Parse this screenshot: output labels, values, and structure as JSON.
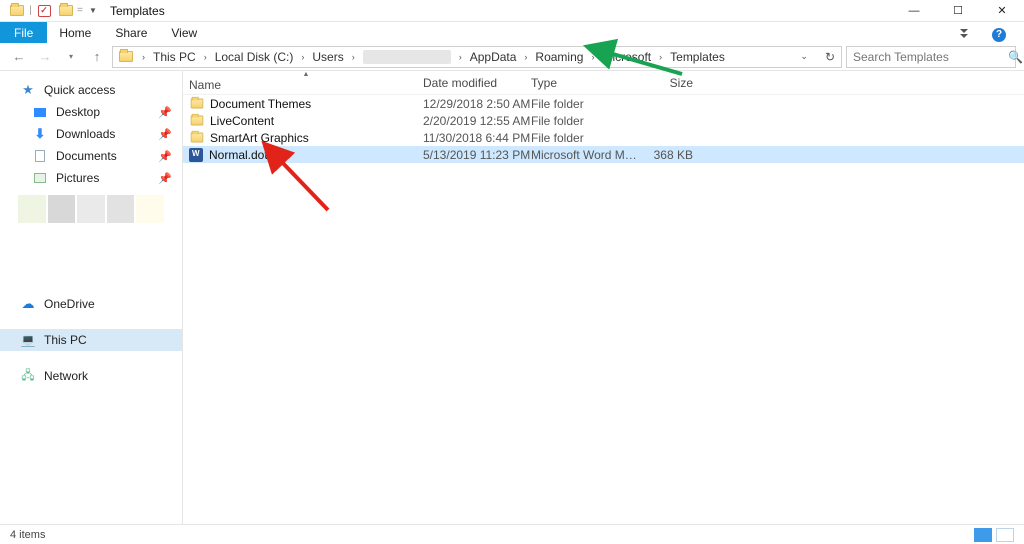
{
  "window": {
    "title": "Templates"
  },
  "ribbon": {
    "file": "File",
    "home": "Home",
    "share": "Share",
    "view": "View"
  },
  "nav": {
    "search_placeholder": "Search Templates",
    "crumbs": [
      "This PC",
      "Local Disk (C:)",
      "Users",
      "",
      "AppData",
      "Roaming",
      "Microsoft",
      "Templates"
    ]
  },
  "sidebar": {
    "quick": "Quick access",
    "desktop": "Desktop",
    "downloads": "Downloads",
    "documents": "Documents",
    "pictures": "Pictures",
    "onedrive": "OneDrive",
    "thispc": "This PC",
    "network": "Network"
  },
  "columns": {
    "name": "Name",
    "date": "Date modified",
    "type": "Type",
    "size": "Size"
  },
  "rows": [
    {
      "name": "Document Themes",
      "date": "12/29/2018 2:50 AM",
      "type": "File folder",
      "size": "",
      "kind": "folder"
    },
    {
      "name": "LiveContent",
      "date": "2/20/2019 12:55 AM",
      "type": "File folder",
      "size": "",
      "kind": "folder"
    },
    {
      "name": "SmartArt Graphics",
      "date": "11/30/2018 6:44 PM",
      "type": "File folder",
      "size": "",
      "kind": "folder"
    },
    {
      "name": "Normal.dotm",
      "date": "5/13/2019 11:23 PM",
      "type": "Microsoft Word Macr...",
      "size": "368 KB",
      "kind": "word",
      "selected": true
    }
  ],
  "status": {
    "count": "4 items"
  }
}
